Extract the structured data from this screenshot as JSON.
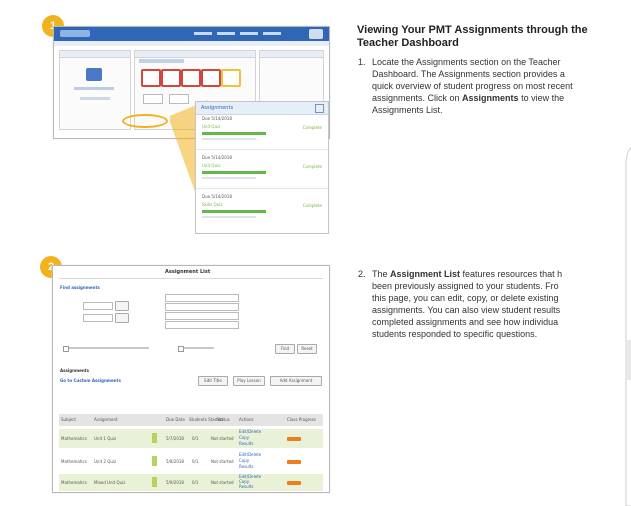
{
  "title": "Viewing Your PMT Assignments through the Teacher Dashboard",
  "title_line1": "Viewing Your PMT Assignments through the",
  "title_line2": "Teacher Dashboard",
  "badges": [
    "1",
    "2"
  ],
  "step1": {
    "number": "1.",
    "lines": [
      "Locate the Assignments section on the Teacher",
      "Dashboard. The Assignments section provides a",
      "quick overview of student progress on most recent",
      "assignments. Click on ",
      "Assignments",
      " to view the",
      "Assignments List."
    ]
  },
  "step2": {
    "number": "2.",
    "line1_pre": "The ",
    "line1_bold": "Assignment List",
    "line1_post": " features resources that h",
    "lines": [
      "been previously assigned to your students. Fro",
      "this page, you can edit, copy, or delete existing",
      "assignments. You can also view student results",
      "completed assignments and see how individua",
      "students responded to specific questions."
    ]
  },
  "zoom_panel": {
    "title": "Assignments",
    "items": [
      {
        "heading": "Due 5/14/2018",
        "name": "Unit Quiz",
        "link": "Complete"
      },
      {
        "heading": "Due 5/14/2018",
        "name": "Unit Quiz",
        "link": "Complete"
      },
      {
        "heading": "Due 5/14/2018",
        "name": "Skills Quiz",
        "link": "Complete"
      }
    ]
  },
  "assignment_list": {
    "title": "Assignment List",
    "find_label": "Find assignments",
    "section_label": "Assignments",
    "link": "Go to Custom Assignments",
    "buttons": [
      "Edit Title",
      "Play Lesson",
      "Add Assignment"
    ],
    "filter_buttons": [
      "Find",
      "Reset"
    ],
    "columns": [
      "Subject",
      "Assignment",
      "",
      "Due Date",
      "Students Started",
      "Status",
      "Actions",
      "Class Progress"
    ],
    "rows": [
      {
        "subject": "Mathematics",
        "assignment": "Unit 1 Quiz",
        "due": "5/7/2018",
        "started": "0/1",
        "status": "Not started",
        "actions": [
          "Edit/Delete",
          "Copy",
          "Results"
        ]
      },
      {
        "subject": "Mathematics",
        "assignment": "Unit 2 Quiz",
        "due": "5/8/2018",
        "started": "0/1",
        "status": "Not started",
        "actions": [
          "Edit/Delete",
          "Copy",
          "Results"
        ]
      },
      {
        "subject": "Mathematics",
        "assignment": "Mixed Unit Quiz",
        "due": "5/9/2018",
        "started": "0/1",
        "status": "Not started",
        "actions": [
          "Edit/Delete",
          "Copy",
          "Results"
        ]
      }
    ]
  },
  "colors": {
    "badge": "#f2b21d",
    "header_blue": "#2f66b6",
    "progress_green": "#64b84a",
    "card_red": "#d4463c",
    "card_yellow": "#f0c23a",
    "book_orange": "#f1ad22"
  }
}
